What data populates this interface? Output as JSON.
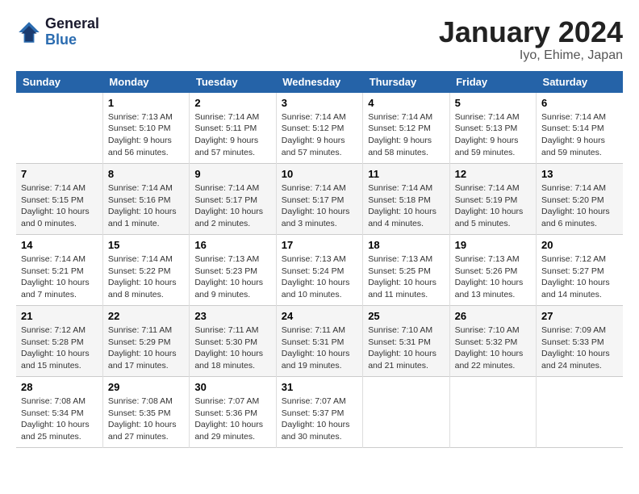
{
  "header": {
    "logo_line1": "General",
    "logo_line2": "Blue",
    "month_title": "January 2024",
    "location": "Iyo, Ehime, Japan"
  },
  "weekdays": [
    "Sunday",
    "Monday",
    "Tuesday",
    "Wednesday",
    "Thursday",
    "Friday",
    "Saturday"
  ],
  "weeks": [
    [
      {
        "day": "",
        "sunrise": "",
        "sunset": "",
        "daylight": ""
      },
      {
        "day": "1",
        "sunrise": "Sunrise: 7:13 AM",
        "sunset": "Sunset: 5:10 PM",
        "daylight": "Daylight: 9 hours and 56 minutes."
      },
      {
        "day": "2",
        "sunrise": "Sunrise: 7:14 AM",
        "sunset": "Sunset: 5:11 PM",
        "daylight": "Daylight: 9 hours and 57 minutes."
      },
      {
        "day": "3",
        "sunrise": "Sunrise: 7:14 AM",
        "sunset": "Sunset: 5:12 PM",
        "daylight": "Daylight: 9 hours and 57 minutes."
      },
      {
        "day": "4",
        "sunrise": "Sunrise: 7:14 AM",
        "sunset": "Sunset: 5:12 PM",
        "daylight": "Daylight: 9 hours and 58 minutes."
      },
      {
        "day": "5",
        "sunrise": "Sunrise: 7:14 AM",
        "sunset": "Sunset: 5:13 PM",
        "daylight": "Daylight: 9 hours and 59 minutes."
      },
      {
        "day": "6",
        "sunrise": "Sunrise: 7:14 AM",
        "sunset": "Sunset: 5:14 PM",
        "daylight": "Daylight: 9 hours and 59 minutes."
      }
    ],
    [
      {
        "day": "7",
        "sunrise": "Sunrise: 7:14 AM",
        "sunset": "Sunset: 5:15 PM",
        "daylight": "Daylight: 10 hours and 0 minutes."
      },
      {
        "day": "8",
        "sunrise": "Sunrise: 7:14 AM",
        "sunset": "Sunset: 5:16 PM",
        "daylight": "Daylight: 10 hours and 1 minute."
      },
      {
        "day": "9",
        "sunrise": "Sunrise: 7:14 AM",
        "sunset": "Sunset: 5:17 PM",
        "daylight": "Daylight: 10 hours and 2 minutes."
      },
      {
        "day": "10",
        "sunrise": "Sunrise: 7:14 AM",
        "sunset": "Sunset: 5:17 PM",
        "daylight": "Daylight: 10 hours and 3 minutes."
      },
      {
        "day": "11",
        "sunrise": "Sunrise: 7:14 AM",
        "sunset": "Sunset: 5:18 PM",
        "daylight": "Daylight: 10 hours and 4 minutes."
      },
      {
        "day": "12",
        "sunrise": "Sunrise: 7:14 AM",
        "sunset": "Sunset: 5:19 PM",
        "daylight": "Daylight: 10 hours and 5 minutes."
      },
      {
        "day": "13",
        "sunrise": "Sunrise: 7:14 AM",
        "sunset": "Sunset: 5:20 PM",
        "daylight": "Daylight: 10 hours and 6 minutes."
      }
    ],
    [
      {
        "day": "14",
        "sunrise": "Sunrise: 7:14 AM",
        "sunset": "Sunset: 5:21 PM",
        "daylight": "Daylight: 10 hours and 7 minutes."
      },
      {
        "day": "15",
        "sunrise": "Sunrise: 7:14 AM",
        "sunset": "Sunset: 5:22 PM",
        "daylight": "Daylight: 10 hours and 8 minutes."
      },
      {
        "day": "16",
        "sunrise": "Sunrise: 7:13 AM",
        "sunset": "Sunset: 5:23 PM",
        "daylight": "Daylight: 10 hours and 9 minutes."
      },
      {
        "day": "17",
        "sunrise": "Sunrise: 7:13 AM",
        "sunset": "Sunset: 5:24 PM",
        "daylight": "Daylight: 10 hours and 10 minutes."
      },
      {
        "day": "18",
        "sunrise": "Sunrise: 7:13 AM",
        "sunset": "Sunset: 5:25 PM",
        "daylight": "Daylight: 10 hours and 11 minutes."
      },
      {
        "day": "19",
        "sunrise": "Sunrise: 7:13 AM",
        "sunset": "Sunset: 5:26 PM",
        "daylight": "Daylight: 10 hours and 13 minutes."
      },
      {
        "day": "20",
        "sunrise": "Sunrise: 7:12 AM",
        "sunset": "Sunset: 5:27 PM",
        "daylight": "Daylight: 10 hours and 14 minutes."
      }
    ],
    [
      {
        "day": "21",
        "sunrise": "Sunrise: 7:12 AM",
        "sunset": "Sunset: 5:28 PM",
        "daylight": "Daylight: 10 hours and 15 minutes."
      },
      {
        "day": "22",
        "sunrise": "Sunrise: 7:11 AM",
        "sunset": "Sunset: 5:29 PM",
        "daylight": "Daylight: 10 hours and 17 minutes."
      },
      {
        "day": "23",
        "sunrise": "Sunrise: 7:11 AM",
        "sunset": "Sunset: 5:30 PM",
        "daylight": "Daylight: 10 hours and 18 minutes."
      },
      {
        "day": "24",
        "sunrise": "Sunrise: 7:11 AM",
        "sunset": "Sunset: 5:31 PM",
        "daylight": "Daylight: 10 hours and 19 minutes."
      },
      {
        "day": "25",
        "sunrise": "Sunrise: 7:10 AM",
        "sunset": "Sunset: 5:31 PM",
        "daylight": "Daylight: 10 hours and 21 minutes."
      },
      {
        "day": "26",
        "sunrise": "Sunrise: 7:10 AM",
        "sunset": "Sunset: 5:32 PM",
        "daylight": "Daylight: 10 hours and 22 minutes."
      },
      {
        "day": "27",
        "sunrise": "Sunrise: 7:09 AM",
        "sunset": "Sunset: 5:33 PM",
        "daylight": "Daylight: 10 hours and 24 minutes."
      }
    ],
    [
      {
        "day": "28",
        "sunrise": "Sunrise: 7:08 AM",
        "sunset": "Sunset: 5:34 PM",
        "daylight": "Daylight: 10 hours and 25 minutes."
      },
      {
        "day": "29",
        "sunrise": "Sunrise: 7:08 AM",
        "sunset": "Sunset: 5:35 PM",
        "daylight": "Daylight: 10 hours and 27 minutes."
      },
      {
        "day": "30",
        "sunrise": "Sunrise: 7:07 AM",
        "sunset": "Sunset: 5:36 PM",
        "daylight": "Daylight: 10 hours and 29 minutes."
      },
      {
        "day": "31",
        "sunrise": "Sunrise: 7:07 AM",
        "sunset": "Sunset: 5:37 PM",
        "daylight": "Daylight: 10 hours and 30 minutes."
      },
      {
        "day": "",
        "sunrise": "",
        "sunset": "",
        "daylight": ""
      },
      {
        "day": "",
        "sunrise": "",
        "sunset": "",
        "daylight": ""
      },
      {
        "day": "",
        "sunrise": "",
        "sunset": "",
        "daylight": ""
      }
    ]
  ]
}
